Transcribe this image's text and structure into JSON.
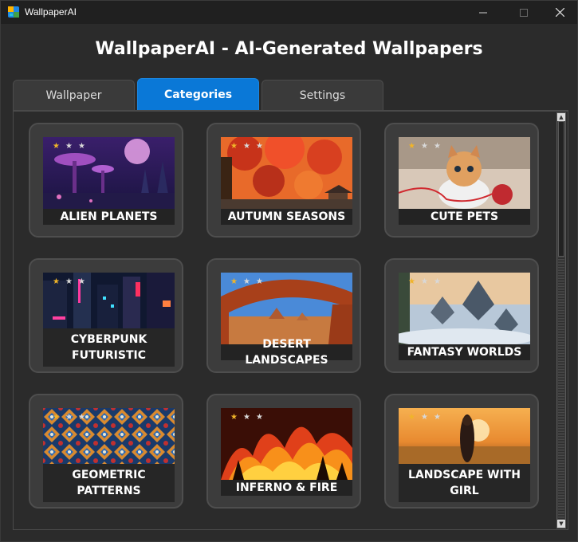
{
  "window": {
    "title": "WallpaperAI"
  },
  "header": {
    "title": "WallpaperAI - AI-Generated Wallpapers"
  },
  "tabs": [
    {
      "label": "Wallpaper",
      "active": false
    },
    {
      "label": "Categories",
      "active": true
    },
    {
      "label": "Settings",
      "active": false
    }
  ],
  "categories": [
    {
      "name": "ALIEN PLANETS",
      "rating": 1,
      "max_rating": 3
    },
    {
      "name": "AUTUMN SEASONS",
      "rating": 1,
      "max_rating": 3
    },
    {
      "name": "CUTE PETS",
      "rating": 1,
      "max_rating": 3
    },
    {
      "name": "CYBERPUNK FUTURISTIC",
      "line1": "CYBERPUNK",
      "line2": "FUTURISTIC",
      "rating": 1,
      "max_rating": 3
    },
    {
      "name": "DESERT LANDSCAPES",
      "rating": 1,
      "max_rating": 3
    },
    {
      "name": "FANTASY WORLDS",
      "rating": 1,
      "max_rating": 3
    },
    {
      "name": "GEOMETRIC PATTERNS",
      "line1": "GEOMETRIC",
      "line2": "PATTERNS",
      "rating": 1,
      "max_rating": 3
    },
    {
      "name": "INFERNO & FIRE",
      "rating": 1,
      "max_rating": 3
    },
    {
      "name": "LANDSCAPE WITH GIRL",
      "line1": "LANDSCAPE WITH",
      "line2": "GIRL",
      "rating": 1,
      "max_rating": 3
    }
  ],
  "colors": {
    "accent": "#0a78d7",
    "star_on": "#f0b429",
    "star_off": "#d8d8d8"
  }
}
